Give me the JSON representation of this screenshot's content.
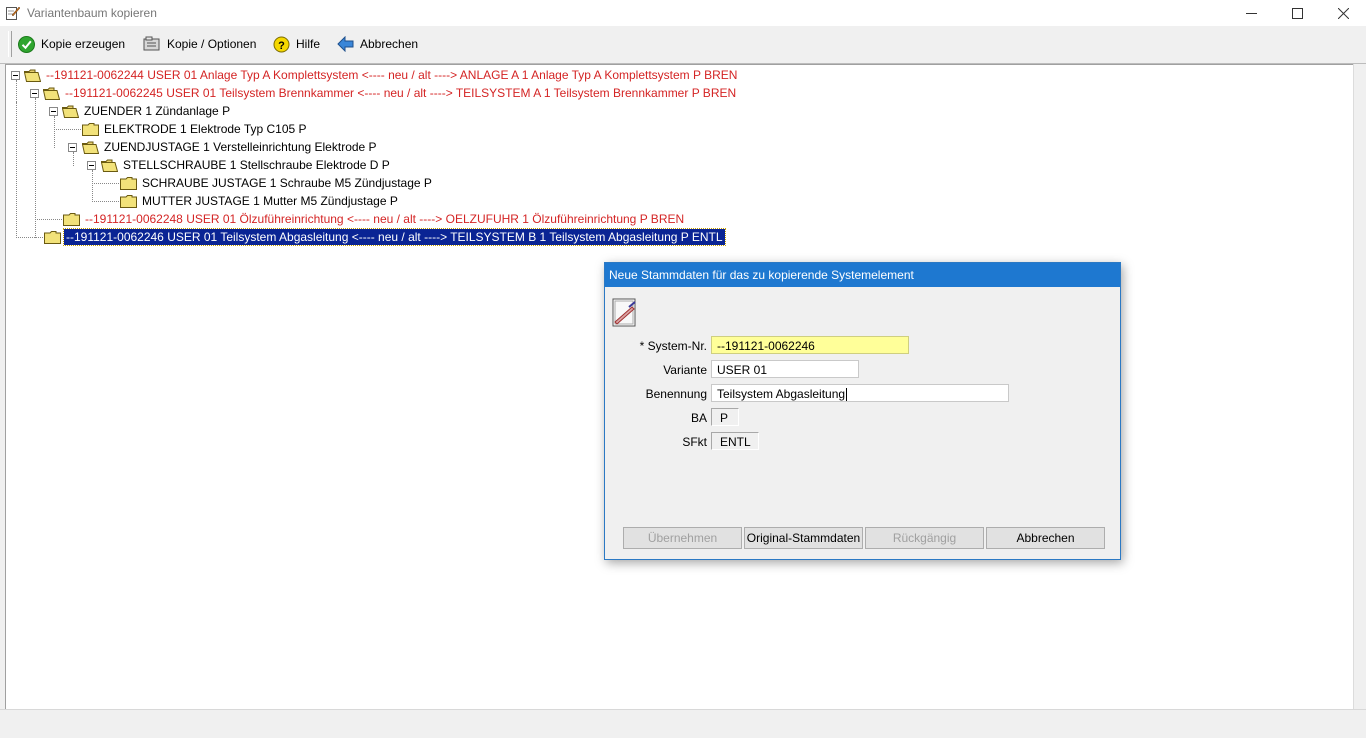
{
  "window": {
    "title": "Variantenbaum kopieren"
  },
  "toolbar": {
    "create_copy": "Kopie erzeugen",
    "copy_options": "Kopie / Optionen",
    "help": "Hilfe",
    "cancel": "Abbrechen"
  },
  "tree": {
    "rows": [
      {
        "label": "--191121-0062244 USER 01 Anlage Typ A  Komplettsystem    <---- neu / alt ---->    ANLAGE A 1 Anlage Typ A  Komplettsystem P BREN",
        "color": "#d42424"
      },
      {
        "label": "--191121-0062245 USER 01 Teilsystem Brennkammer    <---- neu / alt ---->    TEILSYSTEM A 1 Teilsystem Brennkammer P BREN",
        "color": "#d42424"
      },
      {
        "label": "ZUENDER 1 Zündanlage P",
        "color": "#000000"
      },
      {
        "label": "ELEKTRODE 1 Elektrode Typ C105 P",
        "color": "#000000"
      },
      {
        "label": "ZUENDJUSTAGE 1 Verstelleinrichtung Elektrode P",
        "color": "#000000"
      },
      {
        "label": "STELLSCHRAUBE 1 Stellschraube Elektrode D P",
        "color": "#000000"
      },
      {
        "label": "SCHRAUBE JUSTAGE 1 Schraube M5 Zündjustage P",
        "color": "#000000"
      },
      {
        "label": "MUTTER JUSTAGE 1 Mutter M5 Zündjustage P",
        "color": "#000000"
      },
      {
        "label": "--191121-0062248 USER 01 Ölzuführeinrichtung    <---- neu / alt ---->    OELZUFUHR 1 Ölzuführeinrichtung P BREN",
        "color": "#d42424"
      },
      {
        "label": "--191121-0062246 USER 01 Teilsystem Abgasleitung    <---- neu / alt ---->    TEILSYSTEM B 1 Teilsystem Abgasleitung P ENTL",
        "color": "#ffffff",
        "selected": true
      }
    ]
  },
  "dialog": {
    "title": "Neue Stammdaten für das zu kopierende Systemelement",
    "system_nr_label": "* System-Nr.",
    "system_nr_value": "--191121-0062246",
    "variante_label": "Variante",
    "variante_value": "USER 01",
    "benennung_label": "Benennung",
    "benennung_value": "Teilsystem Abgasleitung",
    "ba_label": "BA",
    "ba_value": "P",
    "sfkt_label": "SFkt",
    "sfkt_value": "ENTL",
    "buttons": {
      "apply": "Übernehmen",
      "original": "Original-Stammdaten",
      "undo": "Rückgängig",
      "cancel": "Abbrechen"
    }
  }
}
